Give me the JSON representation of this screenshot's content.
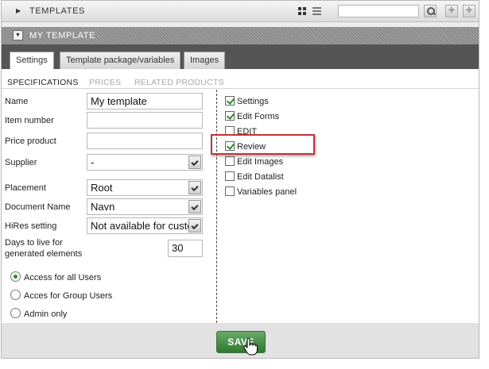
{
  "topbar": {
    "title": "TEMPLATES",
    "search_value": ""
  },
  "panel": {
    "title": "MY TEMPLATE"
  },
  "tabs": [
    {
      "label": "Settings",
      "active": true
    },
    {
      "label": "Template package/variables",
      "active": false
    },
    {
      "label": "Images",
      "active": false
    }
  ],
  "subtabs": [
    {
      "label": "SPECIFICATIONS",
      "active": true
    },
    {
      "label": "PRICES",
      "active": false
    },
    {
      "label": "RELATED PRODUCTS",
      "active": false
    }
  ],
  "form": {
    "name": {
      "label": "Name",
      "value": "My template"
    },
    "item_number": {
      "label": "Item number",
      "value": ""
    },
    "price_product": {
      "label": "Price product",
      "value": ""
    },
    "supplier": {
      "label": "Supplier",
      "value": "-"
    },
    "placement": {
      "label": "Placement",
      "value": "Root"
    },
    "document_name": {
      "label": "Document Name",
      "value": "Navn"
    },
    "hires": {
      "label": "HiRes setting",
      "value": "Not available for customer"
    },
    "days": {
      "label_line1": "Days to live for",
      "label_line2": "generated elements",
      "value": "30"
    }
  },
  "access": [
    {
      "label": "Access for all Users",
      "selected": true
    },
    {
      "label": "Acces for Group Users",
      "selected": false
    },
    {
      "label": "Admin only",
      "selected": false
    }
  ],
  "permissions": [
    {
      "label": "Settings",
      "checked": true
    },
    {
      "label": "Edit Forms",
      "checked": true
    },
    {
      "label": "EDIT",
      "checked": false
    },
    {
      "label": "Review",
      "checked": true
    },
    {
      "label": "Edit Images",
      "checked": false
    },
    {
      "label": "Edit Datalist",
      "checked": false
    },
    {
      "label": "Variables panel",
      "checked": false
    }
  ],
  "footer": {
    "save_label": "SAVE"
  },
  "colors": {
    "save_green": "#3f8a3f",
    "highlight_red": "#c0343a",
    "header_gray": "#8c8c8c"
  }
}
